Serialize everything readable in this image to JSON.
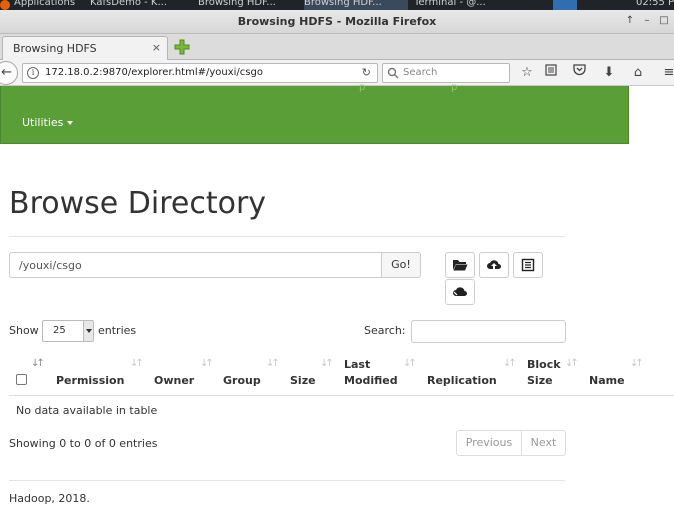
{
  "taskbar": {
    "applications": "Applications",
    "item1": "KafsDemo - K...",
    "item2": "Browsing HDF...",
    "item3": "Browsing HDF...",
    "item4": "Terminal - @...",
    "clock": "02:55 P"
  },
  "window": {
    "title": "Browsing HDFS - Mozilla Firefox"
  },
  "browser": {
    "tab_label": "Browsing HDFS",
    "tab_close": "×",
    "url": "172.18.0.2:9870/explorer.html#/youxi/csgo",
    "search_placeholder": "Search"
  },
  "navbar": {
    "utilities_label": "Utilities"
  },
  "page": {
    "title": "Browse Directory",
    "path_value": "/youxi/csgo",
    "go_label": "Go!"
  },
  "table_controls": {
    "show_label": "Show",
    "page_size": "25",
    "entries_label": "entries",
    "search_label": "Search:"
  },
  "table": {
    "columns": {
      "permission": "Permission",
      "owner": "Owner",
      "group": "Group",
      "size": "Size",
      "last_modified_1": "Last",
      "last_modified_2": "Modified",
      "replication": "Replication",
      "block_size_1": "Block",
      "block_size_2": "Size",
      "name": "Name"
    },
    "empty_message": "No data available in table",
    "info": "Showing 0 to 0 of 0 entries",
    "previous_label": "Previous",
    "next_label": "Next"
  },
  "footer": {
    "text": "Hadoop, 2018."
  },
  "colors": {
    "navbar_green": "#5a9e38",
    "title_text": "#333333"
  }
}
